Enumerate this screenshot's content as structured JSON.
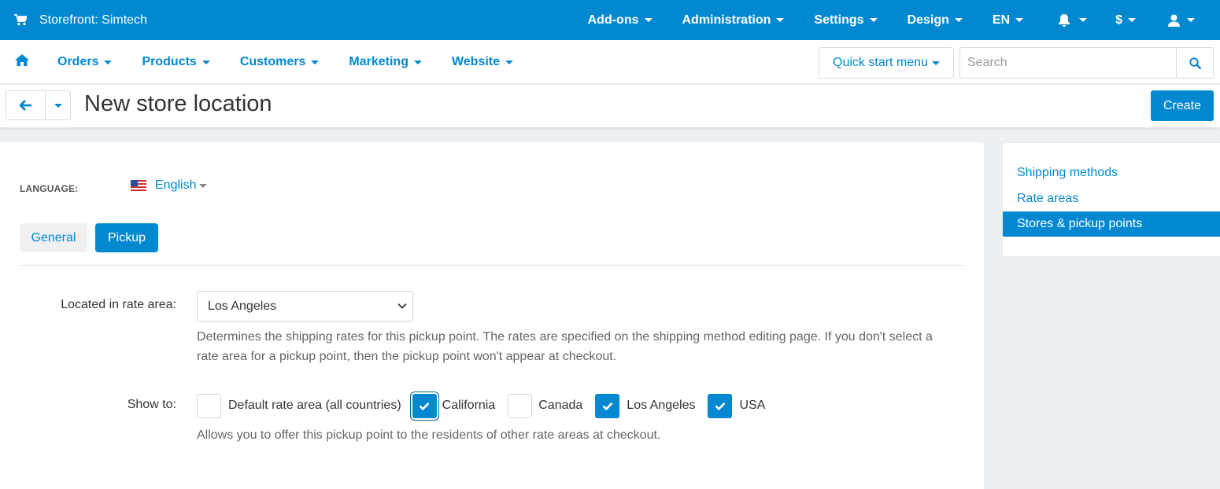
{
  "topbar": {
    "storefront": "Storefront: Simtech",
    "nav": [
      {
        "label": "Add-ons"
      },
      {
        "label": "Administration"
      },
      {
        "label": "Settings"
      },
      {
        "label": "Design"
      },
      {
        "label": "EN"
      },
      {
        "icon": "bell-icon"
      },
      {
        "label": "$"
      },
      {
        "icon": "user-icon"
      }
    ]
  },
  "mainnav": {
    "home_icon": "home-icon",
    "items": [
      {
        "label": "Orders"
      },
      {
        "label": "Products"
      },
      {
        "label": "Customers"
      },
      {
        "label": "Marketing"
      },
      {
        "label": "Website"
      }
    ],
    "quick_start": "Quick start menu",
    "search_placeholder": "Search",
    "search_value": ""
  },
  "titlebar": {
    "title": "New store location",
    "create_label": "Create"
  },
  "form": {
    "language_label": "LANGUAGE:",
    "language_value": "English",
    "tabs": [
      {
        "label": "General",
        "active": false
      },
      {
        "label": "Pickup",
        "active": true
      }
    ],
    "rate_area_label": "Located in rate area:",
    "rate_area_value": "Los Angeles",
    "rate_area_help_1": "Determines the shipping rates for this pickup point. The rates are specified on the shipping method editing page. If you don't select a",
    "rate_area_help_2": "rate area for a pickup point, then the pickup point won't appear at checkout.",
    "show_to_label": "Show to:",
    "show_to_options": [
      {
        "label": "Default rate area (all countries)",
        "checked": false
      },
      {
        "label": "California",
        "checked": true
      },
      {
        "label": "Canada",
        "checked": false
      },
      {
        "label": "Los Angeles",
        "checked": true
      },
      {
        "label": "USA",
        "checked": true
      }
    ],
    "show_to_help": "Allows you to offer this pickup point to the residents of other rate areas at checkout."
  },
  "sidebar": {
    "items": [
      {
        "label": "Shipping methods",
        "active": false
      },
      {
        "label": "Rate areas",
        "active": false
      },
      {
        "label": "Stores & pickup points",
        "active": true
      }
    ]
  },
  "colors": {
    "brand": "#0288d1",
    "background": "#edf0f3"
  }
}
